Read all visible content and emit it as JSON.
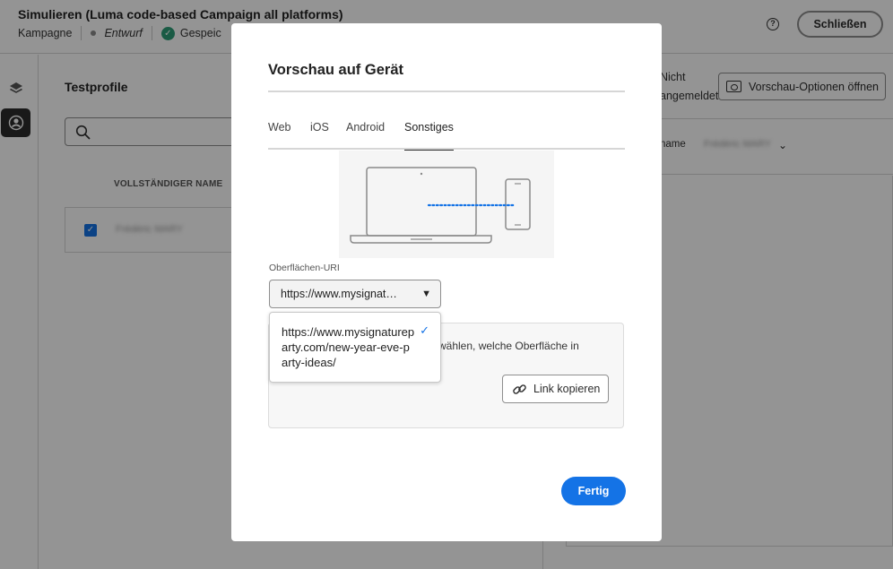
{
  "header": {
    "title": "Simulieren (Luma code-based Campaign all platforms)",
    "breadcrumb_type": "Kampagne",
    "status": "Entwurf",
    "saved_label": "Gespeic",
    "close_label": "Schließen"
  },
  "left_panel": {
    "title": "Testprofile",
    "search_placeholder": "",
    "column_header": "VOLLSTÄNDIGER NAME",
    "rows": [
      {
        "name": "Frédéric MARY",
        "checked": true
      }
    ]
  },
  "right_panel": {
    "status_line1": "Nicht",
    "status_line2": "angemeldet",
    "preview_options_label": "Vorschau-Optionen öffnen",
    "name_label": "name",
    "name_value": "Frédéric MARY"
  },
  "dialog": {
    "title": "Vorschau auf Gerät",
    "tabs": [
      "Web",
      "iOS",
      "Android",
      "Sonstiges"
    ],
    "active_tab": "Sonstiges",
    "uri_label": "Oberflächen-URI",
    "uri_selected": "https://www.mysignat…",
    "dropdown_option": "https://www.mysignatureparty.com/new-year-eve-party-ideas/",
    "info_text": "wählen, welche Oberfläche in",
    "copy_link_label": "Link kopieren",
    "done_label": "Fertig"
  },
  "colors": {
    "accent": "#1473e6",
    "saved_green": "#2d9d78",
    "illustration_dots": "#1473e6"
  }
}
